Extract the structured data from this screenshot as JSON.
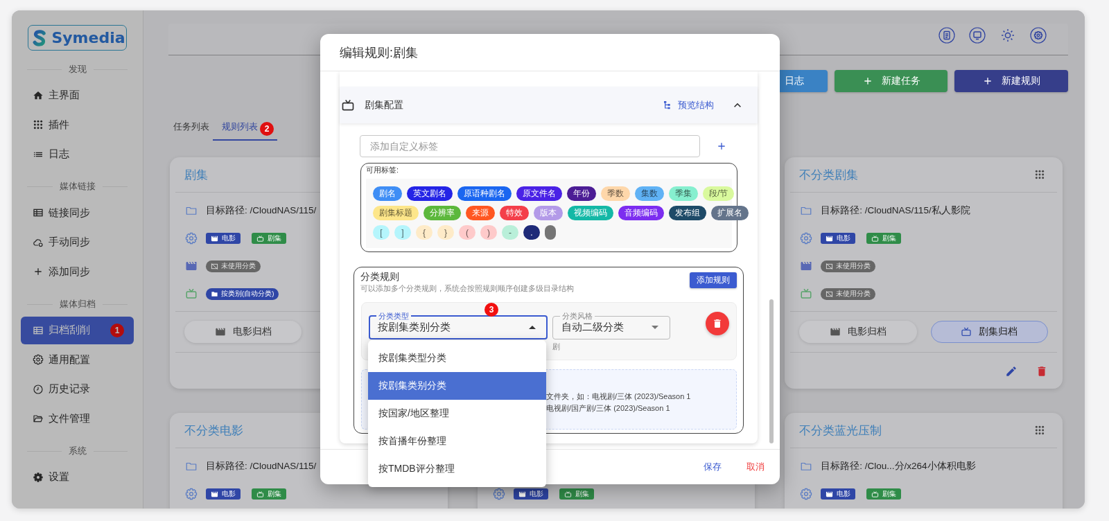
{
  "logo": {
    "text": "Symedia"
  },
  "sidebar": {
    "sections": [
      {
        "heading": "发现",
        "items": [
          {
            "label": "主界面",
            "selected": false
          },
          {
            "label": "插件",
            "selected": false
          },
          {
            "label": "日志",
            "selected": false
          }
        ]
      },
      {
        "heading": "媒体链接",
        "items": [
          {
            "label": "链接同步",
            "selected": false
          },
          {
            "label": "手动同步",
            "selected": false
          },
          {
            "label": "添加同步",
            "selected": false
          }
        ]
      },
      {
        "heading": "媒体归档",
        "items": [
          {
            "label": "归档刮削",
            "selected": true,
            "badge": "1"
          },
          {
            "label": "通用配置",
            "selected": false
          },
          {
            "label": "历史记录",
            "selected": false
          },
          {
            "label": "文件管理",
            "selected": false
          }
        ]
      },
      {
        "heading": "系统",
        "items": [
          {
            "label": "设置",
            "selected": false
          }
        ]
      }
    ]
  },
  "toolbar": {
    "buttons": [
      {
        "label": "日志",
        "kind": "plain",
        "color": "#3a82c4"
      },
      {
        "label": "新建任务",
        "kind": "add",
        "color": "#3a8f54"
      },
      {
        "label": "新建规则",
        "kind": "add",
        "color": "#363e8a"
      }
    ]
  },
  "tabs": [
    {
      "label": "任务列表",
      "selected": false
    },
    {
      "label": "规则列表",
      "selected": true,
      "badge": "2"
    }
  ],
  "card_columns": [
    [
      {
        "title": "剧集",
        "path": "目标路径: /CloudNAS/115/",
        "type_tags": [
          "电影",
          "剧集"
        ],
        "movie_category": {
          "label": "未使用分类",
          "kind": "unused"
        },
        "tv_category": {
          "label": "按类别(自动分类)",
          "kind": "auto"
        },
        "archive_buttons": [
          {
            "label": "电影归档",
            "selected": false
          }
        ]
      },
      {
        "title": "不分类电影",
        "path": "目标路径: /CloudNAS/115/",
        "type_tags": [
          "电影",
          "剧集"
        ]
      }
    ],
    [
      {
        "type_tags": [
          "电影",
          "剧集"
        ]
      }
    ],
    [
      {
        "title": "不分类剧集",
        "drag_handle": true,
        "path": "目标路径: /CloudNAS/115/私人影院",
        "type_tags": [
          "电影",
          "剧集"
        ],
        "movie_category": {
          "label": "未使用分类",
          "kind": "unused"
        },
        "tv_category": {
          "label": "未使用分类",
          "kind": "unused"
        },
        "archive_buttons": [
          {
            "label": "电影归档",
            "selected": false
          },
          {
            "label": "剧集归档",
            "selected": true
          }
        ],
        "actions": true
      },
      {
        "title": "不分类蓝光压制",
        "drag_handle": true,
        "path": "目标路径: /Clou...分/x264小体积电影",
        "type_tags": [
          "电影",
          "剧集"
        ]
      }
    ]
  ],
  "modal": {
    "title": "编辑规则:剧集",
    "section": {
      "title": "剧集配置",
      "expanded": true,
      "preview_button": "预览结构"
    },
    "custom_tag": {
      "placeholder": "添加自定义标签"
    },
    "available_tags": {
      "label": "可用标签:",
      "chip_rows": [
        [
          {
            "label": "剧名",
            "color": "#3f8ef5"
          },
          {
            "label": "英文剧名",
            "color": "#2424e6"
          },
          {
            "label": "原语种剧名",
            "color": "#1a66f0"
          },
          {
            "label": "原文件名",
            "color": "#4a22e6"
          },
          {
            "label": "年份",
            "color": "#4c1d95"
          },
          {
            "label": "季数",
            "color": "#fed7aa"
          },
          {
            "label": "集数",
            "color": "#60b2f5"
          },
          {
            "label": "季集",
            "color": "#86efcf"
          },
          {
            "label": "段/节",
            "color": "#d9f99d"
          }
        ],
        [
          {
            "label": "剧集标题",
            "color": "#fde68a"
          },
          {
            "label": "分辨率",
            "color": "#5cb83c"
          },
          {
            "label": "来源",
            "color": "#ff5722"
          },
          {
            "label": "特效",
            "color": "#f43f4a"
          },
          {
            "label": "版本",
            "color": "#b39ae8"
          },
          {
            "label": "视频编码",
            "color": "#14b8a6"
          },
          {
            "label": "音频编码",
            "color": "#7c2df0"
          },
          {
            "label": "发布组",
            "color": "#1e4a68"
          },
          {
            "label": "扩展名",
            "color": "#64748b"
          }
        ],
        [
          {
            "label": "[",
            "color": "#b5f5fc"
          },
          {
            "label": "]",
            "color": "#b5f5fc"
          },
          {
            "label": "{",
            "color": "#feebc8"
          },
          {
            "label": "}",
            "color": "#feebc8"
          },
          {
            "label": "(",
            "color": "#fecaca"
          },
          {
            "label": ")",
            "color": "#fecaca"
          },
          {
            "label": "-",
            "color": "#b9efd9"
          },
          {
            "label": ".",
            "color": "#1e2a78"
          },
          {
            "color": "#757575"
          }
        ]
      ]
    },
    "rules": {
      "title": "分类规则",
      "description": "可以添加多个分类规则，系统会按照规则顺序创建多级目录结构",
      "add_button": "添加规则",
      "items": [
        {
          "badge": "3",
          "type_field": {
            "label": "分类类型",
            "value": "按剧集类别分类",
            "open": true,
            "options": [
              {
                "label": "按剧集类型分类",
                "selected": false
              },
              {
                "label": "按剧集类别分类",
                "selected": true
              },
              {
                "label": "按国家/地区整理",
                "selected": false
              },
              {
                "label": "按首播年份整理",
                "selected": false
              },
              {
                "label": "按TMDB评分整理",
                "selected": false
              }
            ]
          },
          "style_field": {
            "label": "分类风格",
            "value": "自动二级分类",
            "open": false
          },
          "hint": "剧"
        }
      ],
      "preview": [
        "文件夹，如：电视剧/三体 (2023)/Season 1",
        "电视剧/国产剧/三体 (2023)/Season 1"
      ]
    },
    "footer": {
      "save": "保存",
      "cancel": "取消"
    }
  }
}
